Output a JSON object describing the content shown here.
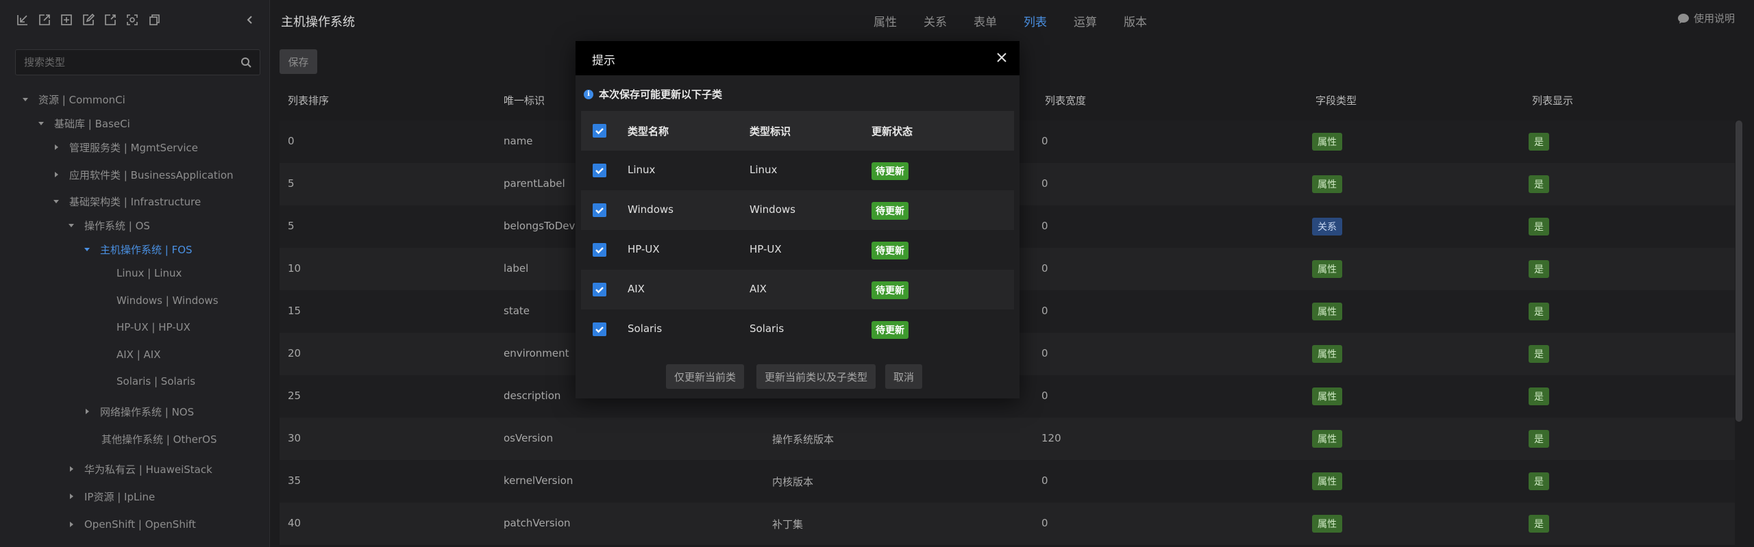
{
  "sidebar": {
    "toolbar_icons": [
      "import-icon",
      "export-icon",
      "add-icon",
      "edit-icon",
      "refresh-icon",
      "scan-icon",
      "copy-icon"
    ],
    "search_placeholder": "搜索类型",
    "tree": [
      {
        "label": "资源 | CommonCi",
        "expanded": true
      },
      {
        "label": "基础库 | BaseCi",
        "expanded": true
      },
      {
        "label": "管理服务类 | MgmtService",
        "expanded": false
      },
      {
        "label": "应用软件类 | BusinessApplication",
        "expanded": false
      },
      {
        "label": "基础架构类 | Infrastructure",
        "expanded": true
      },
      {
        "label": "操作系统 | OS",
        "expanded": true
      },
      {
        "label": "主机操作系统 | FOS",
        "expanded": true,
        "active": true
      },
      {
        "label": "Linux | Linux"
      },
      {
        "label": "Windows | Windows"
      },
      {
        "label": "HP-UX | HP-UX"
      },
      {
        "label": "AIX | AIX"
      },
      {
        "label": "Solaris | Solaris"
      },
      {
        "label": "网络操作系统 | NOS",
        "expanded": false
      },
      {
        "label": "其他操作系统 | OtherOS"
      },
      {
        "label": "华为私有云 | HuaweiStack",
        "expanded": false
      },
      {
        "label": "IP资源 | IpLine",
        "expanded": false
      },
      {
        "label": "OpenShift | OpenShift",
        "expanded": false
      }
    ]
  },
  "header": {
    "title": "主机操作系统",
    "tabs": [
      "属性",
      "关系",
      "表单",
      "列表",
      "运算",
      "版本"
    ],
    "active_tab": "列表",
    "help_label": "使用说明"
  },
  "toolbar": {
    "save_label": "保存"
  },
  "table": {
    "columns": [
      "列表排序",
      "唯一标识",
      "列表宽度",
      "字段类型",
      "列表显示"
    ],
    "rows": [
      {
        "order": "0",
        "id": "name",
        "name": "",
        "width": "0",
        "type": "属性",
        "type_kind": "attr",
        "display": "是"
      },
      {
        "order": "5",
        "id": "parentLabel",
        "name": "",
        "width": "0",
        "type": "属性",
        "type_kind": "attr",
        "display": "是"
      },
      {
        "order": "5",
        "id": "belongsToDevic",
        "name": "",
        "width": "0",
        "type": "关系",
        "type_kind": "rel",
        "display": "是"
      },
      {
        "order": "10",
        "id": "label",
        "name": "",
        "width": "0",
        "type": "属性",
        "type_kind": "attr",
        "display": "是"
      },
      {
        "order": "15",
        "id": "state",
        "name": "",
        "width": "0",
        "type": "属性",
        "type_kind": "attr",
        "display": "是"
      },
      {
        "order": "20",
        "id": "environment",
        "name": "",
        "width": "0",
        "type": "属性",
        "type_kind": "attr",
        "display": "是"
      },
      {
        "order": "25",
        "id": "description",
        "name": "",
        "width": "0",
        "type": "属性",
        "type_kind": "attr",
        "display": "是"
      },
      {
        "order": "30",
        "id": "osVersion",
        "name": "操作系统版本",
        "width": "120",
        "type": "属性",
        "type_kind": "attr",
        "display": "是"
      },
      {
        "order": "35",
        "id": "kernelVersion",
        "name": "内核版本",
        "width": "0",
        "type": "属性",
        "type_kind": "attr",
        "display": "是"
      },
      {
        "order": "40",
        "id": "patchVersion",
        "name": "补丁集",
        "width": "0",
        "type": "属性",
        "type_kind": "attr",
        "display": "是"
      }
    ]
  },
  "modal": {
    "title": "提示",
    "notice": "本次保存可能更新以下子类",
    "columns": [
      "类型名称",
      "类型标识",
      "更新状态"
    ],
    "rows": [
      {
        "name": "Linux",
        "id": "Linux",
        "status": "待更新",
        "checked": true
      },
      {
        "name": "Windows",
        "id": "Windows",
        "status": "待更新",
        "checked": true
      },
      {
        "name": "HP-UX",
        "id": "HP-UX",
        "status": "待更新",
        "checked": true
      },
      {
        "name": "AIX",
        "id": "AIX",
        "status": "待更新",
        "checked": true
      },
      {
        "name": "Solaris",
        "id": "Solaris",
        "status": "待更新",
        "checked": true
      }
    ],
    "buttons": {
      "update_current": "仅更新当前类",
      "update_all": "更新当前类以及子类型",
      "cancel": "取消"
    }
  }
}
